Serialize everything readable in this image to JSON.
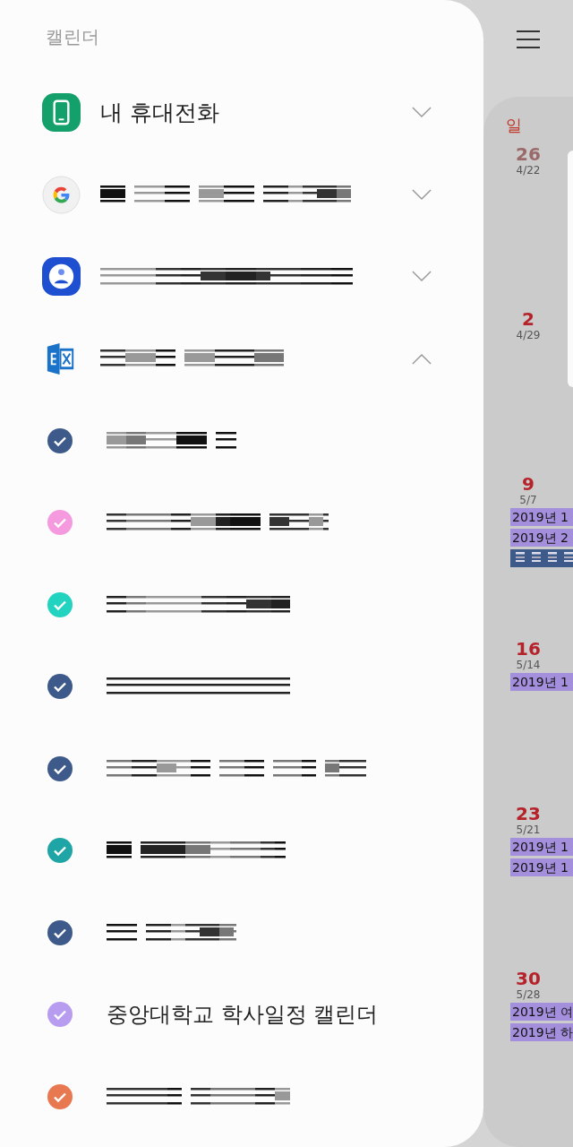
{
  "drawer": {
    "title": "캘린더",
    "accounts": [
      {
        "kind": "phone",
        "label": "내 휴대전화",
        "expanded": false
      },
      {
        "kind": "google",
        "expanded": false
      },
      {
        "kind": "contact",
        "expanded": false
      },
      {
        "kind": "exchange",
        "expanded": true
      }
    ],
    "calendars": [
      {
        "color": "#3d5a8a",
        "checked": true
      },
      {
        "color": "#f59adf",
        "checked": true
      },
      {
        "color": "#22d3c0",
        "checked": true
      },
      {
        "color": "#3d5a8a",
        "checked": true
      },
      {
        "color": "#3d5a8a",
        "checked": true
      },
      {
        "color": "#1fa5a5",
        "checked": true
      },
      {
        "color": "#3d5a8a",
        "checked": true
      },
      {
        "color": "#b79cf0",
        "checked": true,
        "label": "중앙대학교 학사일정 캘린더"
      },
      {
        "color": "#e8784f",
        "checked": true
      }
    ]
  },
  "calendar": {
    "weekday": "일",
    "weeks": [
      {
        "day": "26",
        "date": "4/22",
        "dimmed": true
      },
      {
        "day": "2",
        "date": "4/29",
        "dimmed": false
      },
      {
        "day": "9",
        "date": "5/7",
        "dimmed": false,
        "events": [
          {
            "label": "2019년 1",
            "color": "#a48fdc"
          },
          {
            "label": "2019년 2",
            "color": "#a48fdc"
          },
          {
            "color": "#3d5a8a"
          }
        ]
      },
      {
        "day": "16",
        "date": "5/14",
        "dimmed": false,
        "events": [
          {
            "label": "2019년 1",
            "color": "#a48fdc"
          }
        ]
      },
      {
        "day": "23",
        "date": "5/21",
        "dimmed": false,
        "events": [
          {
            "label": "2019년 1",
            "color": "#a48fdc"
          },
          {
            "label": "2019년 1",
            "color": "#a48fdc"
          }
        ]
      },
      {
        "day": "30",
        "date": "5/28",
        "dimmed": false,
        "events": [
          {
            "label": "2019년 여",
            "color": "#a48fdc"
          },
          {
            "label": "2019년 하",
            "color": "#a48fdc"
          }
        ]
      }
    ]
  }
}
